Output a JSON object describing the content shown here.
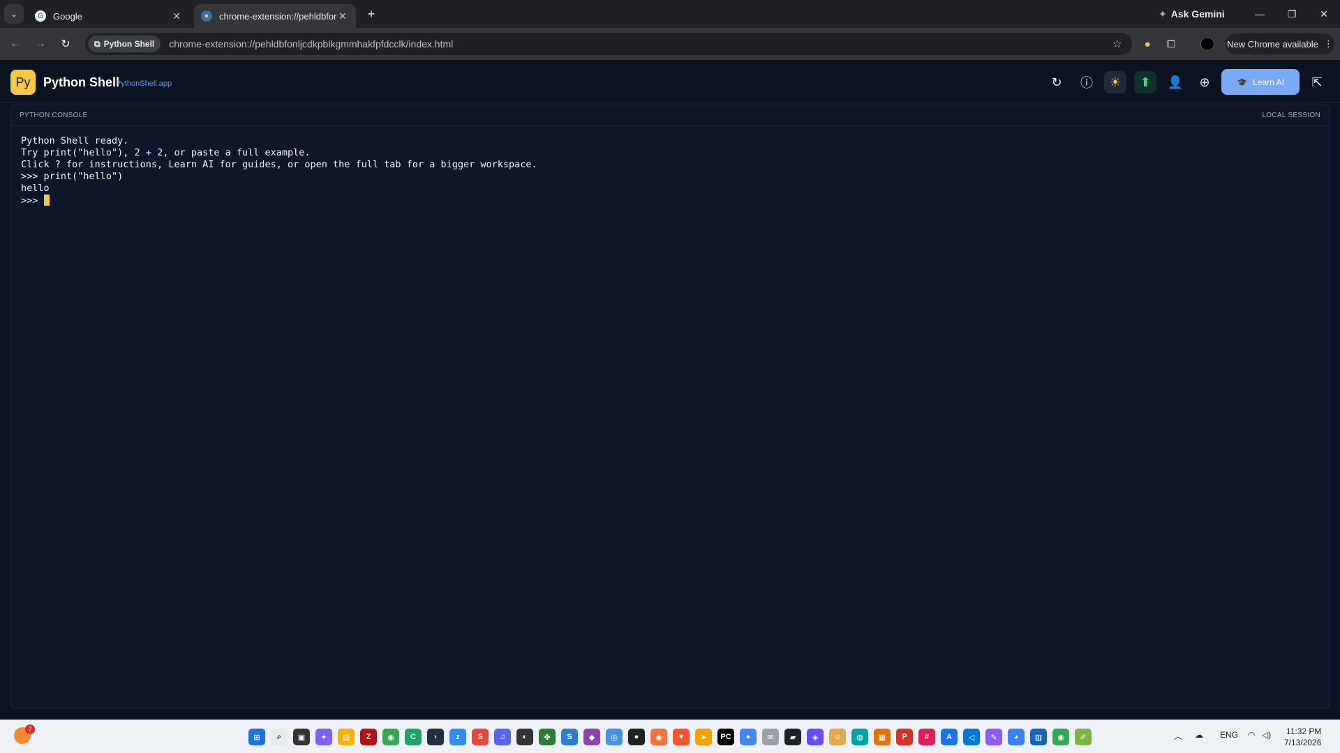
{
  "browser": {
    "tabs": [
      {
        "title": "Google",
        "favicon": "google-icon",
        "active": false
      },
      {
        "title": "chrome-extension://pehldbfonl",
        "favicon": "python-icon",
        "active": true
      }
    ],
    "ask_gemini": "Ask Gemini",
    "site_chip": "Python Shell",
    "url": "chrome-extension://pehldbfonljcdkpblkgmmhakfpfdcclk/index.html",
    "new_chrome": "New Chrome available"
  },
  "app": {
    "logo_text": "Py",
    "title": "Python Shell",
    "link": "PythonShell.app",
    "learn_label": "Learn AI",
    "accent": "#f6c945",
    "learn_color": "#7aa9f7"
  },
  "console": {
    "label": "PYTHON CONSOLE",
    "session": "LOCAL SESSION",
    "lines": [
      "Python Shell ready.",
      "Try print(\"hello\"), 2 + 2, or paste a full example.",
      "Click ? for instructions, Learn AI for guides, or open the full tab for a bigger workspace.",
      ">>> print(\"hello\")",
      "hello"
    ],
    "prompt": ">>> "
  },
  "taskbar": {
    "notification_count": "7",
    "lang": "ENG",
    "time": "11:32 PM",
    "date": "7/13/2026"
  }
}
